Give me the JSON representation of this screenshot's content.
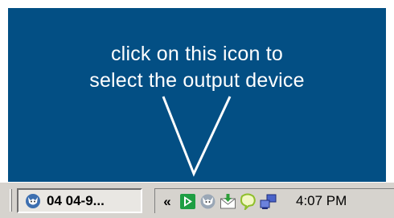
{
  "annotation": {
    "line1": "click on this icon to",
    "line2": "select the output device"
  },
  "taskbar": {
    "task_button_label": "04 04-9...",
    "task_button_icon": "wolf-head-icon",
    "tray_chevron": "«",
    "tray_icons": [
      "media-play-icon",
      "wolf-head-icon",
      "mail-download-icon",
      "speech-bubble-icon",
      "network-computers-icon"
    ],
    "clock": "4:07 PM"
  },
  "colors": {
    "desktop_blue": "#034f84",
    "taskbar_gray": "#d6d3ce"
  }
}
